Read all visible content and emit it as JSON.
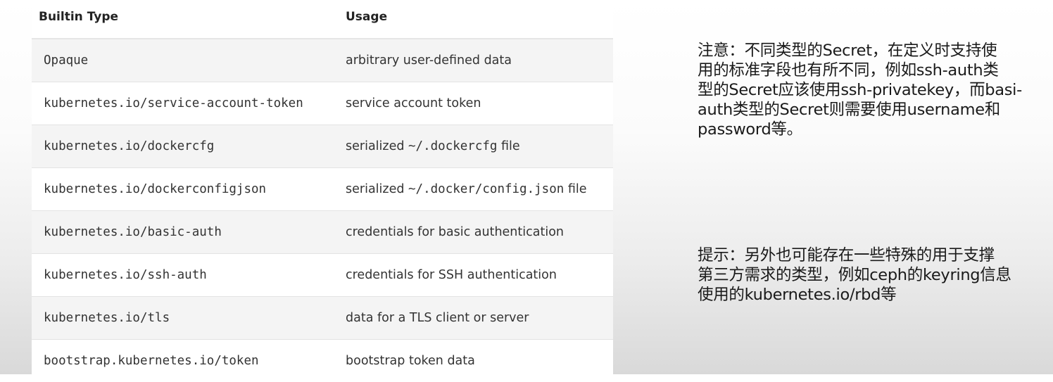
{
  "table": {
    "headers": [
      "Builtin Type",
      "Usage"
    ],
    "rows": [
      {
        "type": "Opaque",
        "usage": [
          "arbitrary user-defined data"
        ]
      },
      {
        "type": "kubernetes.io/service-account-token",
        "usage": [
          "service account token"
        ]
      },
      {
        "type": "kubernetes.io/dockercfg",
        "usage": [
          "serialized ",
          "~/.dockercfg",
          " file"
        ]
      },
      {
        "type": "kubernetes.io/dockerconfigjson",
        "usage": [
          "serialized ",
          "~/.docker/config.json",
          " file"
        ]
      },
      {
        "type": "kubernetes.io/basic-auth",
        "usage": [
          "credentials for basic authentication"
        ]
      },
      {
        "type": "kubernetes.io/ssh-auth",
        "usage": [
          "credentials for SSH authentication"
        ]
      },
      {
        "type": "kubernetes.io/tls",
        "usage": [
          "data for a TLS client or server"
        ]
      },
      {
        "type": "bootstrap.kubernetes.io/token",
        "usage": [
          "bootstrap token data"
        ]
      }
    ]
  },
  "notes": {
    "note1_lines": [
      "注意：不同类型的Secret，在定义时支持使",
      "用的标准字段也有所不同，例如ssh-auth类",
      "型的Secret应该使用ssh-privatekey，而basi-",
      "auth类型的Secret则需要使用username和",
      "password等。"
    ],
    "note2_lines": [
      "提示：另外也可能存在一些特殊的用于支撑",
      "第三方需求的类型，例如ceph的keyring信息",
      "使用的kubernetes.io/rbd等"
    ]
  }
}
